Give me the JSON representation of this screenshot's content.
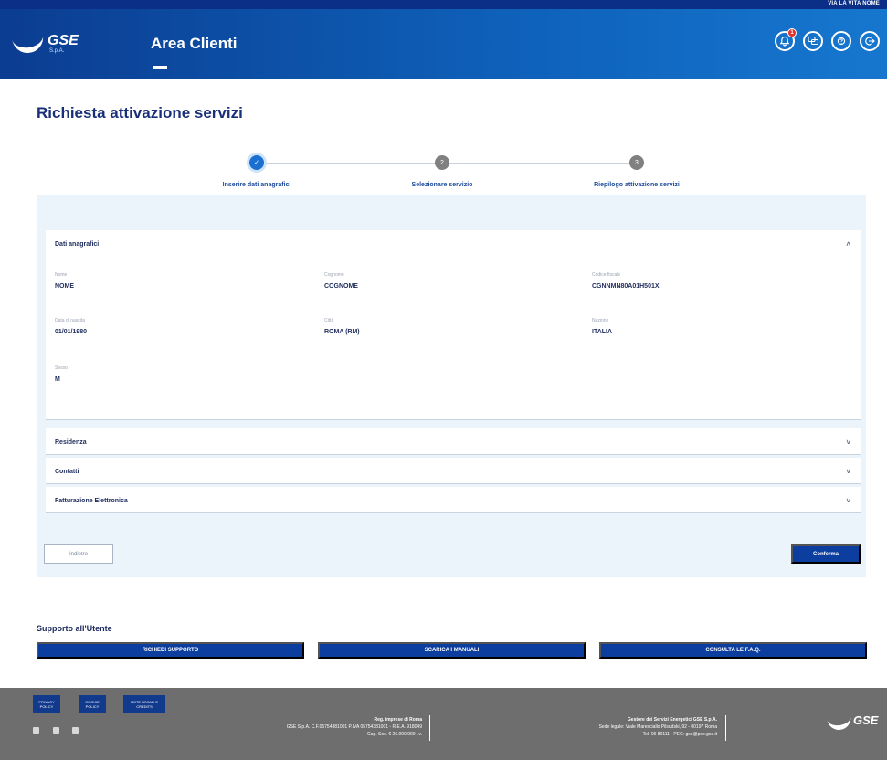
{
  "header": {
    "user_label": "VIA LA VITA NOME",
    "logo_text": "GSE",
    "logo_sub": "S.p.A.",
    "app_title": "Area Clienti",
    "notification_count": "1",
    "icons": [
      "notification-icon",
      "chat-icon",
      "help-icon",
      "logout-icon"
    ]
  },
  "page": {
    "title": "Richiesta attivazione servizi"
  },
  "stepper": {
    "steps": [
      {
        "label": "Inserire dati anagrafici",
        "state": "done",
        "mark": "✓"
      },
      {
        "label": "Selezionare servizio",
        "state": "pending",
        "mark": "2"
      },
      {
        "label": "Riepilogo attivazione servizi",
        "state": "pending",
        "mark": "3"
      }
    ]
  },
  "form": {
    "sections": [
      {
        "title": "Dati anagrafici",
        "chevron": "˄",
        "expanded": true
      },
      {
        "title": "Residenza",
        "chevron": "˅"
      },
      {
        "title": "Contatti",
        "chevron": "˅"
      },
      {
        "title": "Fatturazione Elettronica",
        "chevron": "˅"
      }
    ],
    "anagrafica": {
      "nome": {
        "label": "Nome",
        "value": "NOME"
      },
      "cognome": {
        "label": "Cognome",
        "value": "COGNOME"
      },
      "codice_fiscale": {
        "label": "Codice fiscale",
        "value": "CGNNMN80A01H501X"
      },
      "data_nascita": {
        "label": "Data di nascita",
        "value": "01/01/1980"
      },
      "citta": {
        "label": "Città",
        "value": "ROMA (RM)"
      },
      "nazione": {
        "label": "Nazione",
        "value": "ITALIA"
      },
      "sesso": {
        "label": "Sesso",
        "value": "M"
      }
    },
    "back_label": "Indietro",
    "confirm_label": "Conferma"
  },
  "support": {
    "title": "Supporto all'Utente",
    "buttons": [
      "RICHIEDI SUPPORTO",
      "SCARICA I MANUALI",
      "CONSULTA LE F.A.Q."
    ]
  },
  "footer": {
    "buttons": [
      "PRIVACY POLICY",
      "COOKIE POLICY",
      "NOTE LEGALI E CREDITS"
    ],
    "registered_office": {
      "title": "Reg. imprese di Roma",
      "line1": "GSE S.p.A. C.F.05754381001 P.IVA 05754381001 - R.E.A. 918049",
      "line2": "Cap. Soc. € 26.000.000 i.v."
    },
    "company": {
      "title": "Gestore dei Servizi Energetici GSE S.p.A.",
      "line1": "Sede legale: Viale Maresciallo Pilsudski, 92 - 00197 Roma",
      "line2": "Tel. 06 80111 - PEC: gse@pec.gse.it"
    },
    "logo_text": "GSE"
  }
}
